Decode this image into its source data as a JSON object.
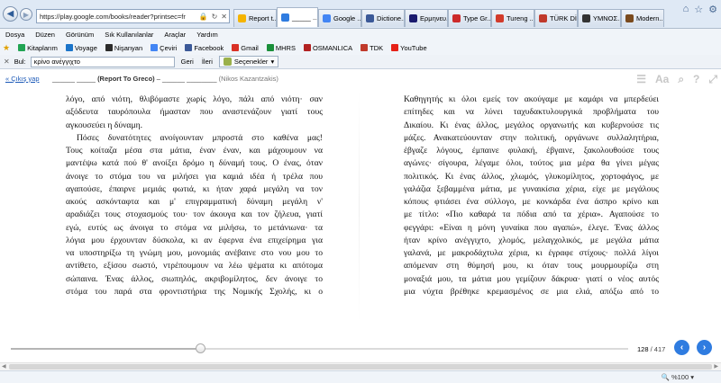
{
  "browser": {
    "address": "https://play.google.com/books/reader?printsec=fr",
    "tabs": [
      {
        "label": "Report t...",
        "color": "#f5b400",
        "active": false
      },
      {
        "label": "_____ ...",
        "color": "#2f7ce0",
        "active": true
      },
      {
        "label": "Google ...",
        "color": "#4285f4",
        "active": false
      },
      {
        "label": "Dictione...",
        "color": "#3b5998",
        "active": false
      },
      {
        "label": "Ερμηνευ...",
        "color": "#1a1a6e",
        "active": false
      },
      {
        "label": "Type Gr...",
        "color": "#cc2a2a",
        "active": false
      },
      {
        "label": "Tureng ...",
        "color": "#d23b2b",
        "active": false
      },
      {
        "label": "TÜRK Dİ...",
        "color": "#c0392b",
        "active": false
      },
      {
        "label": "ΥΜΝΟΣ...",
        "color": "#333333",
        "active": false
      },
      {
        "label": "Modern...",
        "color": "#7a4a1d",
        "active": false
      }
    ],
    "menu": [
      "Dosya",
      "Düzen",
      "Görünüm",
      "Sık Kullanılanlar",
      "Araçlar",
      "Yardım"
    ],
    "bookmarks": [
      {
        "label": "Kitaplarım",
        "color": "#21a453"
      },
      {
        "label": "Voyage",
        "color": "#1b74c9"
      },
      {
        "label": "Nişanyan",
        "color": "#2b2b2b"
      },
      {
        "label": "Çeviri",
        "color": "#4285f4"
      },
      {
        "label": "Facebook",
        "color": "#3b5998"
      },
      {
        "label": "Gmail",
        "color": "#d93025"
      },
      {
        "label": "MHRS",
        "color": "#1a8f3a"
      },
      {
        "label": "OSMANLICA",
        "color": "#b22222"
      },
      {
        "label": "TDK",
        "color": "#c0392b"
      },
      {
        "label": "YouTube",
        "color": "#e62117"
      }
    ],
    "find": {
      "label": "Bul:",
      "value": "κρίνο ανέγγιχτο",
      "prev": "Geri",
      "next": "İleri",
      "options": "Seçenekler"
    },
    "zoom": "%100"
  },
  "reader": {
    "back": "« Çıkış yap",
    "title_blank1": "______ _____",
    "title": "(Report To Greco)",
    "title_sep": " – ",
    "author_blank": "______ ________",
    "author": "(Nikos Kazantzakis)",
    "page_current": "128",
    "page_total": " / 417",
    "progress": 0.307
  },
  "left_page": [
    "λόγο, από νιότη, θλιβόμαστε χωρίς λόγο, πάλι από νιότη· σαν",
    "αξόδευτα ταυρόπουλα ήμασταν που αναστενάζουν γιατί τους",
    "αγκουσεύει η δύναμη.",
    "    Πόσες δυνατότητες ανοίγουνταν μπροστά στο καθένα μας!",
    "Τους κοίταζα μέσα στα μάτια, έναν έναν, και μάχουμουν να",
    "μαντέψω κατά πού θ' ανοίξει δρόμο η δύναμή τους. Ο ένας, όταν",
    "άνοιγε το στόμα του να μιλήσει για καμιά ιδέα ή τρέλα που",
    "αγαπούσε, έπαιρνε μεμιάς φωτιά, κι ήταν χαρά μεγάλη να τον",
    "ακούς ασκόνταφτα και μ' επιγραμματική δύναμη μεγάλη ν'",
    "αραδιάζει τους στοχασμούς του· τον άκουγα και τον ζήλευα, γιατί",
    "εγώ, ευτύς ως άνοιγα το στόμα να μιλήσω, το μετάνιωνα· τα",
    "λόγια μου έρχουνταν δύσκολα, κι αν έφερνα ένα επιχείρημα για",
    "να υποστηρίξω τη γνώμη μου, μονομιάς ανέβαινε στο νου μου το",
    "αντίθετο, εξίσου σωστό, ντρέπουμουν να λέω ψέματα κι απότομα",
    "σώπαινα. Ένας άλλος, σιωπηλός, ακριβομίλητος, δεν άνοιγε το",
    "στόμα του παρά στα φροντιστήρια της Νομικής Σχολής, κι ο"
  ],
  "right_page": [
    "Καθηγητής κι όλοι εμείς τον ακούγαμε με καμάρι να μπερδεύει",
    "επίτηδες και να λύνει ταχυδακτυλουργικά προβλήματα του",
    "Δικαίου. Κι ένας άλλος, μεγάλος οργανωτής και κυβερνούσε τις",
    "μάζες. Ανακατεύουνταν στην πολιτική, οργάνωνε συλλαλητήρια,",
    "έβγαζε λόγους, έμπαινε φυλακή, έβγαινε, ξακολουθούσε τους",
    "αγώνες· σίγουρα, λέγαμε όλοι, τούτος μια μέρα θα γίνει μέγας",
    "πολιτικός. Κι ένας άλλος, χλωμός, γλυκομίλητος, χορτοφάγος, με",
    "γαλάζια ξεβαμμένα μάτια, με γυναικίσια χέρια, είχε με μεγάλους",
    "κόπους φτιάσει ένα σύλλογο, με κονκάρδα ένα άσπρο κρίνο και",
    "με τίτλο: «Πιο καθαρά τα πόδια από τα χέρια». Αγαπούσε το",
    "φεγγάρι: «Είναι η μόνη γυναίκα που αγαπώ», έλεγε. Ένας άλλος",
    "ήταν κρίνο ανέγγιχτο, χλομός, μελαγχολικός, με μεγάλα μάτια",
    "γαλανά, με μακροδάχτυλα χέρια, κι έγραφε στίχους· πολλά λίγοι",
    "απόμεναν στη θύμησή μου, κι όταν τους μουρμουρίζω στη",
    "μοναξιά μου, τα μάτια μου γεμίζουν δάκρυα· γιατί ο νέος αυτός",
    "μια νύχτα βρέθηκε κρεμασμένος σε μια ελιά, απόξω από το"
  ]
}
